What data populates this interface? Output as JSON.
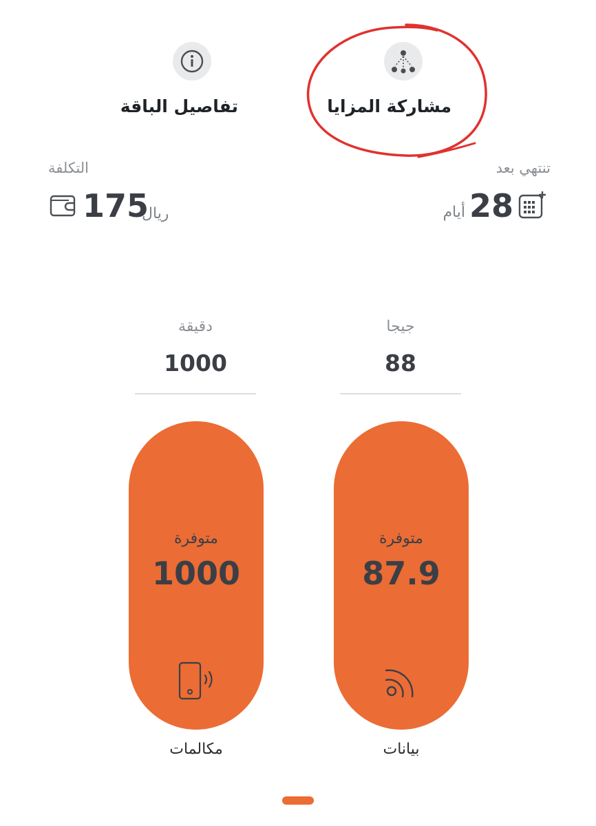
{
  "tabs": [
    {
      "id": "details",
      "label": "تفاصيل الباقة",
      "icon": "info-icon"
    },
    {
      "id": "share",
      "label": "مشاركة المزايا",
      "icon": "share-benefits-icon"
    }
  ],
  "expiry": {
    "label": "تنتهي بعد",
    "value": "28",
    "unit": "أيام",
    "icon": "calendar-icon"
  },
  "cost": {
    "label": "التكلفة",
    "value": "175",
    "unit": "ريال",
    "icon": "wallet-icon"
  },
  "minutes": {
    "unit": "دقيقة",
    "total": "1000",
    "available_label": "متوفرة",
    "available_value": "1000",
    "name": "مكالمات",
    "icon": "phone-call-icon",
    "remaining_fraction": 1.0
  },
  "data": {
    "unit": "جيجا",
    "total": "88",
    "available_label": "متوفرة",
    "available_value": "87.9",
    "name": "بيانات",
    "icon": "data-signal-icon",
    "remaining_fraction": 0.999
  },
  "colors": {
    "accent": "#eb6c34",
    "annotation": "#e0322f",
    "text": "#3b3f45"
  }
}
